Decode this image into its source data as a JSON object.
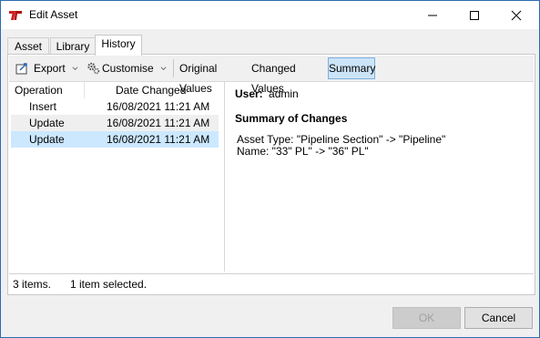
{
  "window": {
    "title": "Edit Asset",
    "minimize_glyph": "—",
    "maximize_glyph": "☐",
    "close_glyph": "✕"
  },
  "tabs": [
    {
      "label": "Asset"
    },
    {
      "label": "Library"
    },
    {
      "label": "History"
    }
  ],
  "toolbar": {
    "export_label": "Export",
    "customise_label": "Customise",
    "original_values_label": "Original Values",
    "changed_values_label": "Changed Values",
    "summary_label": "Summary"
  },
  "history": {
    "columns": [
      "Operation",
      "Date Changed"
    ],
    "rows": [
      {
        "operation": "Insert",
        "date": "16/08/2021 11:21 AM"
      },
      {
        "operation": "Update",
        "date": "16/08/2021 11:21 AM"
      },
      {
        "operation": "Update",
        "date": "16/08/2021 11:21 AM"
      }
    ]
  },
  "detail": {
    "user_label": "User:",
    "user_value": "admin",
    "summary_heading": "Summary of Changes",
    "change_lines": [
      "Asset Type: \"Pipeline Section\" -> \"Pipeline\"",
      "Name: \"33\" PL\" -> \"36\" PL\""
    ]
  },
  "status": {
    "items_count": "3 items.",
    "selection": "1 item selected."
  },
  "buttons": {
    "ok": "OK",
    "cancel": "Cancel"
  },
  "colors": {
    "selection": "#cce8ff",
    "pressed": "#cce4f7",
    "accent": "#2b6cb0",
    "logo": "#d11f1f"
  }
}
